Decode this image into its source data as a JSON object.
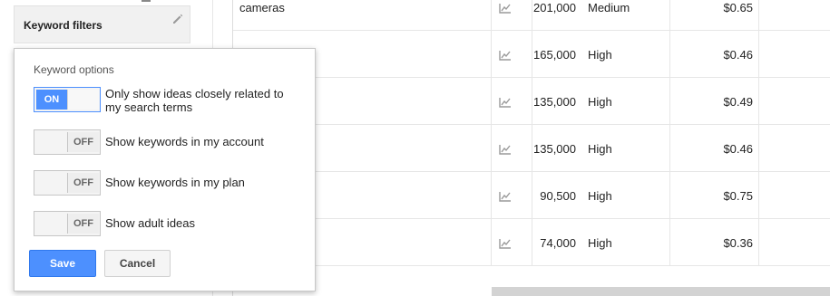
{
  "sidebar": {
    "card_title": "Keyword filters"
  },
  "popup": {
    "title": "Keyword options",
    "options": [
      {
        "state": "ON",
        "label_line1": "Only show ideas closely related to",
        "label_line2": "my search terms"
      },
      {
        "state": "OFF",
        "label_line1": "Show keywords in my account",
        "label_line2": ""
      },
      {
        "state": "OFF",
        "label_line1": "Show keywords in my plan",
        "label_line2": ""
      },
      {
        "state": "OFF",
        "label_line1": "Show adult ideas",
        "label_line2": ""
      }
    ],
    "save_label": "Save",
    "cancel_label": "Cancel"
  },
  "table": {
    "rows": [
      {
        "keyword": "cameras",
        "volume": "201,000",
        "competition": "Medium",
        "bid": "$0.65"
      },
      {
        "keyword": "",
        "volume": "165,000",
        "competition": "High",
        "bid": "$0.46"
      },
      {
        "keyword": "",
        "volume": "135,000",
        "competition": "High",
        "bid": "$0.49"
      },
      {
        "keyword": "",
        "volume": "135,000",
        "competition": "High",
        "bid": "$0.46"
      },
      {
        "keyword": "",
        "volume": "90,500",
        "competition": "High",
        "bid": "$0.75"
      },
      {
        "keyword": "",
        "volume": "74,000",
        "competition": "High",
        "bid": "$0.36"
      }
    ]
  },
  "colors": {
    "accent_blue": "#4d90fe",
    "card_bg": "#f1f1f1"
  }
}
